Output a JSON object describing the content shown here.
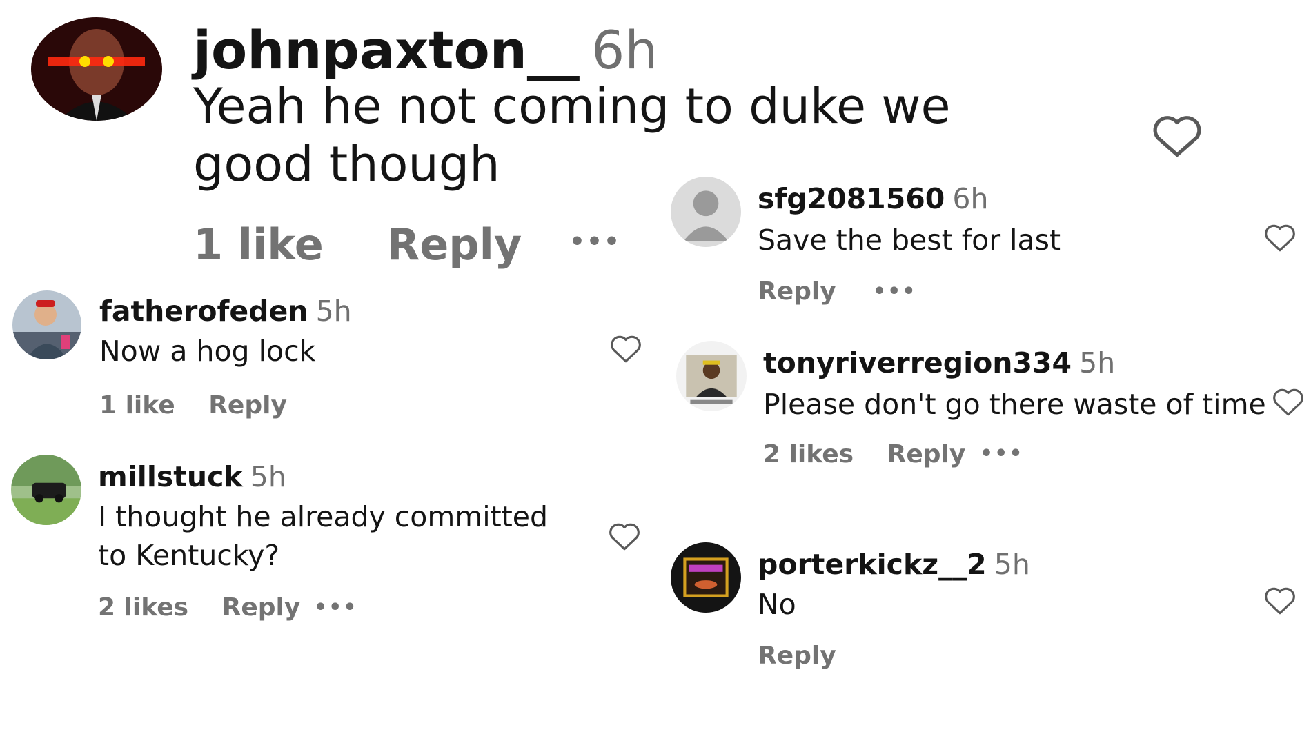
{
  "main_comment": {
    "username": "johnpaxton__",
    "time": "6h",
    "text": "Yeah he not coming to duke we good though",
    "likes": "1 like",
    "reply": "Reply",
    "more": "•••"
  },
  "comments": [
    {
      "username": "fatherofeden",
      "time": "5h",
      "text": "Now a hog lock",
      "likes": "1 like",
      "reply": "Reply"
    },
    {
      "username": "millstuck",
      "time": "5h",
      "text": "I thought he already committed to Kentucky?",
      "likes": "2 likes",
      "reply": "Reply",
      "more": "•••"
    },
    {
      "username": "sfg2081560",
      "time": "6h",
      "text": "Save the best for last",
      "reply": "Reply",
      "more": "•••"
    },
    {
      "username": "tonyriverregion334",
      "time": "5h",
      "text": "Please don't go there waste of time",
      "likes": "2 likes",
      "reply": "Reply",
      "more": "•••"
    },
    {
      "username": "porterkickz__2",
      "time": "5h",
      "text": "No",
      "reply": "Reply"
    }
  ],
  "icons": {
    "like": "heart-outline-icon",
    "more": "more-options-icon"
  },
  "colors": {
    "text": "#141414",
    "muted": "#737373",
    "heart_stroke": "#595959"
  }
}
